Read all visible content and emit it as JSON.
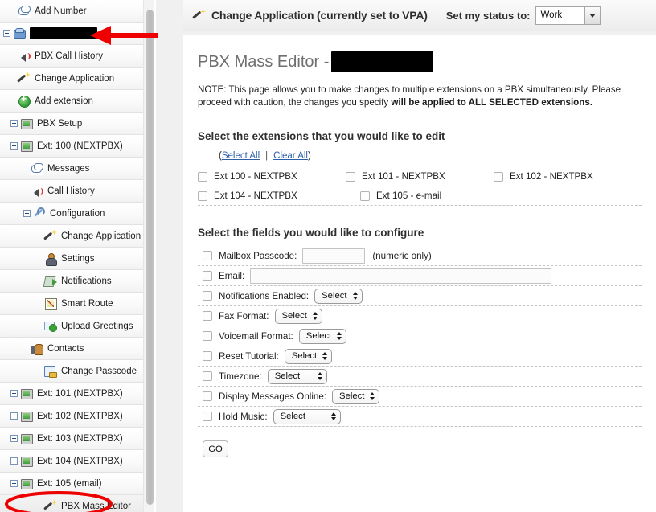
{
  "sidebar": {
    "scrollbar": "vertical-scrollbar",
    "items": [
      {
        "label": "Add Number",
        "icon": "speech-bubble-icon",
        "indent": 22,
        "twisty": null,
        "redacted": false
      },
      {
        "label": "",
        "icon": "phone-icon",
        "indent": 4,
        "twisty": "minus",
        "redacted": true,
        "redact_width": 84
      },
      {
        "label": "PBX Call History",
        "icon": "speaker-icon",
        "indent": 22,
        "twisty": null,
        "redacted": false
      },
      {
        "label": "Change Application",
        "icon": "magic-wand-icon",
        "indent": 22,
        "twisty": null,
        "redacted": false
      },
      {
        "label": "Add extension",
        "icon": "add-green-icon",
        "indent": 22,
        "twisty": null,
        "redacted": false
      },
      {
        "label": "PBX Setup",
        "icon": "monitor-icon",
        "indent": 13,
        "twisty": "plus",
        "redacted": false
      },
      {
        "label": "Ext: 100 (NEXTPBX)",
        "icon": "monitor-icon",
        "indent": 13,
        "twisty": "minus",
        "redacted": false
      },
      {
        "label": "Messages",
        "icon": "speech-bubble-icon",
        "indent": 38,
        "twisty": null,
        "redacted": false
      },
      {
        "label": "Call History",
        "icon": "speaker-icon",
        "indent": 38,
        "twisty": null,
        "redacted": false
      },
      {
        "label": "Configuration",
        "icon": "wrench-icon",
        "indent": 29,
        "twisty": "minus",
        "redacted": false
      },
      {
        "label": "Change Application",
        "icon": "magic-wand-icon",
        "indent": 55,
        "twisty": null,
        "redacted": false
      },
      {
        "label": "Settings",
        "icon": "person-icon",
        "indent": 55,
        "twisty": null,
        "redacted": false
      },
      {
        "label": "Notifications",
        "icon": "notifications-icon",
        "indent": 55,
        "twisty": null,
        "redacted": false
      },
      {
        "label": "Smart Route",
        "icon": "chart-icon",
        "indent": 55,
        "twisty": null,
        "redacted": false
      },
      {
        "label": "Upload Greetings",
        "icon": "upload-icon",
        "indent": 55,
        "twisty": null,
        "redacted": false
      },
      {
        "label": "Contacts",
        "icon": "contacts-icon",
        "indent": 38,
        "twisty": null,
        "redacted": false
      },
      {
        "label": "Change Passcode",
        "icon": "passcode-icon",
        "indent": 55,
        "twisty": null,
        "redacted": false
      },
      {
        "label": "Ext: 101 (NEXTPBX)",
        "icon": "monitor-icon",
        "indent": 13,
        "twisty": "plus",
        "redacted": false
      },
      {
        "label": "Ext: 102 (NEXTPBX)",
        "icon": "monitor-icon",
        "indent": 13,
        "twisty": "plus",
        "redacted": false
      },
      {
        "label": "Ext: 103 (NEXTPBX)",
        "icon": "monitor-icon",
        "indent": 13,
        "twisty": "plus",
        "redacted": false
      },
      {
        "label": "Ext: 104 (NEXTPBX)",
        "icon": "monitor-icon",
        "indent": 13,
        "twisty": "plus",
        "redacted": false
      },
      {
        "label": "Ext: 105 (email)",
        "icon": "monitor-icon",
        "indent": 13,
        "twisty": "plus",
        "redacted": false
      },
      {
        "label": "PBX Mass Editor",
        "icon": "magic-wand-icon",
        "indent": 55,
        "twisty": null,
        "redacted": false,
        "selected": true
      }
    ]
  },
  "topbar": {
    "icon": "magic-wand-icon",
    "title": "Change Application (currently set to VPA)",
    "status_label": "Set my status to:",
    "status_value": "Work"
  },
  "page": {
    "title_prefix": "PBX Mass Editor -",
    "title_redacted": true,
    "note_prefix": "NOTE: This page allows you to make changes to multiple extensions on a PBX simultaneously. Please proceed with caution, the changes you specify ",
    "note_bold": "will be applied to ALL SELECTED extensions."
  },
  "extensions_section": {
    "heading": "Select the extensions that you would like to edit",
    "select_all": "Select All",
    "clear_all": "Clear All",
    "separator": "|",
    "paren_open": "(",
    "paren_close": ")",
    "items": [
      {
        "label": "Ext 100 - NEXTPBX",
        "checked": false
      },
      {
        "label": "Ext 101 - NEXTPBX",
        "checked": false
      },
      {
        "label": "Ext 102 - NEXTPBX",
        "checked": false
      },
      {
        "label": "Ext 104 - NEXTPBX",
        "checked": false
      },
      {
        "label": "Ext 105 - e-mail",
        "checked": false
      }
    ]
  },
  "fields_section": {
    "heading": "Select the fields you would like to configure",
    "select_placeholder": "Select",
    "rows": [
      {
        "label": "Mailbox Passcode:",
        "control": "text",
        "value": "",
        "width": "passcode",
        "hint": "(numeric only)",
        "checked": false
      },
      {
        "label": "Email:",
        "control": "text",
        "value": "",
        "width": "email",
        "hint": "",
        "checked": false
      },
      {
        "label": "Notifications Enabled:",
        "control": "select",
        "value": "Select",
        "size": "narrow",
        "checked": false
      },
      {
        "label": "Fax Format:",
        "control": "select",
        "value": "Select",
        "size": "narrow",
        "checked": false
      },
      {
        "label": "Voicemail Format:",
        "control": "select",
        "value": "Select",
        "size": "narrow",
        "checked": false
      },
      {
        "label": "Reset Tutorial:",
        "control": "select",
        "value": "Select",
        "size": "narrow",
        "checked": false
      },
      {
        "label": "Timezone:",
        "control": "select",
        "value": "Select",
        "size": "wide",
        "checked": false
      },
      {
        "label": "Display Messages Online:",
        "control": "select",
        "value": "Select",
        "size": "narrow",
        "checked": false
      },
      {
        "label": "Hold Music:",
        "control": "select",
        "value": "Select",
        "size": "xwide",
        "checked": false
      }
    ],
    "submit_label": "GO"
  },
  "annotations": {
    "arrow_color": "#ee0000",
    "circle_color": "#ee0000",
    "arrow_target": "redacted-pbx-node",
    "circle_target": "PBX Mass Editor"
  }
}
